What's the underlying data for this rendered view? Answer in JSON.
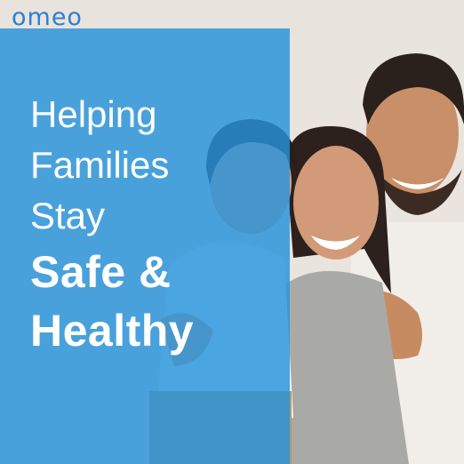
{
  "brand": {
    "logo_text": "omeo",
    "accent_color": "#2b7fd3",
    "panel_color": "#2692dc"
  },
  "headline": {
    "line1": "Helping",
    "line2": "Families",
    "line3": "Stay",
    "line4": "Safe &",
    "line5": "Healthy"
  }
}
